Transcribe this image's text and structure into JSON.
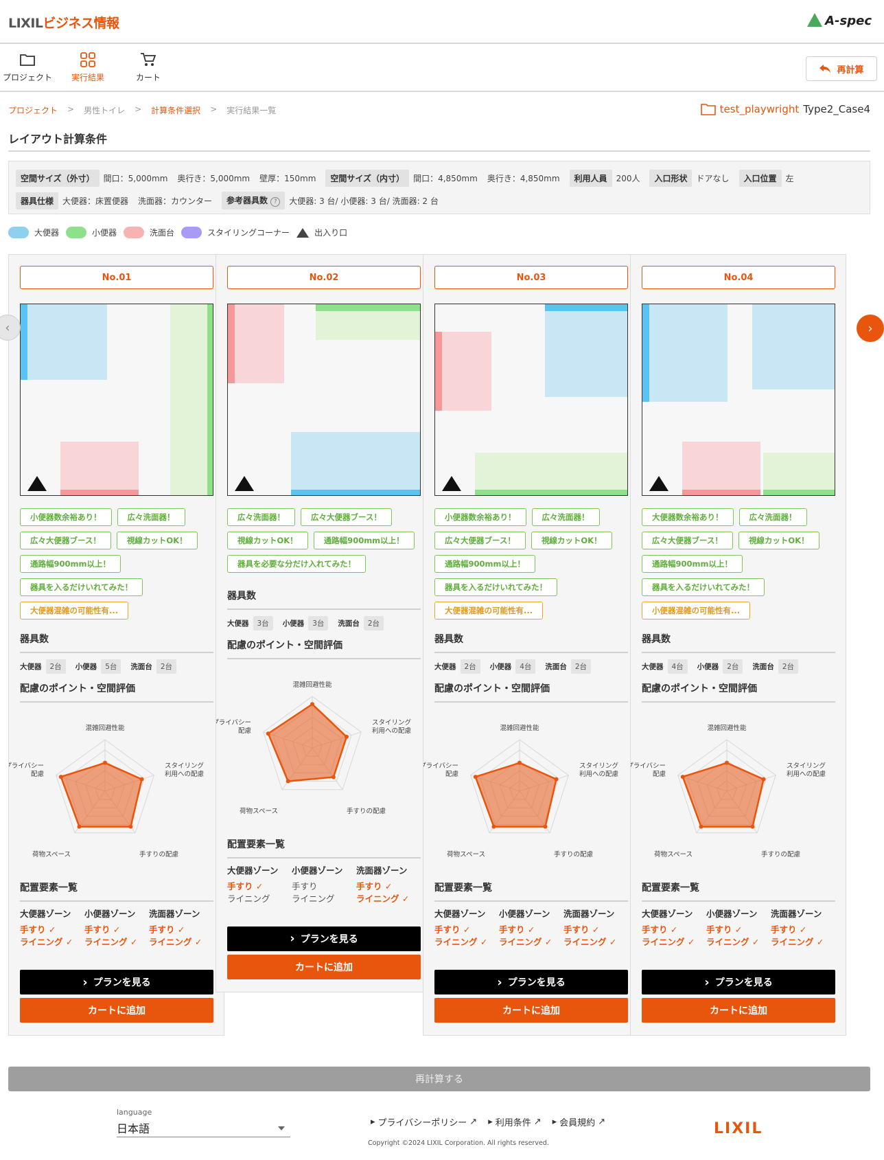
{
  "header": {
    "brand_a": "LIXIL",
    "brand_b": "ビジネス情報",
    "product": "A-spec"
  },
  "toolbar": {
    "items": [
      {
        "label": "プロジェクト",
        "icon": "folder-icon"
      },
      {
        "label": "実行結果",
        "icon": "grid-icon"
      },
      {
        "label": "カート",
        "icon": "cart-icon"
      }
    ],
    "recalc_label": "再計算"
  },
  "breadcrumb": [
    "プロジェクト",
    "男性トイレ",
    "計算条件選択",
    "実行結果一覧"
  ],
  "project": {
    "name": "test_playwright",
    "case": "Type2_Case4"
  },
  "page_title": "レイアウト計算条件",
  "conditions": {
    "outer_tag": "空間サイズ（外寸）",
    "outer_width": "間口：5,000mm",
    "outer_depth": "奥行き：5,000mm",
    "wall": "壁厚：150mm",
    "inner_tag": "空間サイズ（内寸）",
    "inner_width": "間口：4,850mm",
    "inner_depth": "奥行き：4,850mm",
    "users_tag": "利用人員",
    "users": "200人",
    "entry_shape_tag": "入口形状",
    "entry_shape": "ドアなし",
    "entry_pos_tag": "入口位置",
    "entry_pos": "左",
    "spec_tag": "器具仕様",
    "spec_toilet": "大便器：床置便器",
    "spec_sink": "洗面器：カウンター",
    "ref_tag": "参考器具数",
    "ref_counts": "大便器: 3 台/ 小便器: 3 台/ 洗面器: 2 台"
  },
  "legend": [
    {
      "label": "大便器",
      "color": "#8fd0ef"
    },
    {
      "label": "小便器",
      "color": "#8fe08a"
    },
    {
      "label": "洗面台",
      "color": "#f7b2b2"
    },
    {
      "label": "スタイリングコーナー",
      "color": "#a99af5"
    },
    {
      "label": "出入り口"
    }
  ],
  "colors": {
    "accent": "#e8560e",
    "toilet": "#c9e6f5",
    "urinal": "#e3f3d8",
    "sink": "#f8d6d8"
  },
  "radar_axes": [
    "混雑回避性能",
    "スタイリング\n利用への配慮",
    "手すりの配慮",
    "荷物スペース",
    "プライバシー\n配慮"
  ],
  "labels": {
    "counts_title": "器具数",
    "radar_title": "配慮のポイント・空間評価",
    "elements_title": "配置要素一覧",
    "plan_button": "プランを見る",
    "cart_button": "カートに追加",
    "toilet": "大便器",
    "urinal": "小便器",
    "sink": "洗面台",
    "zone_toilet": "大便器ゾーン",
    "zone_urinal": "小便器ゾーン",
    "zone_sink": "洗面器ゾーン",
    "handrail": "手すり",
    "lining": "ライニング"
  },
  "cards": [
    {
      "no": "No.01",
      "chips": [
        {
          "text": "小便器数余裕あり！"
        },
        {
          "text": "広々洗面器！"
        },
        {
          "text": "広々大便器ブース！"
        },
        {
          "text": "視線カットOK！"
        },
        {
          "text": "通路幅900mm以上！"
        },
        {
          "text": "器具を入るだけいれてみた！"
        },
        {
          "text": "大便器混雑の可能性有...",
          "warn": true
        }
      ],
      "counts": {
        "toilet": "2台",
        "urinal": "5台",
        "sink": "2台"
      },
      "scores": [
        0.55,
        0.75,
        0.85,
        0.85,
        0.9
      ],
      "elements": [
        [
          "手すり ✓",
          "ライニング ✓"
        ],
        [
          "手すり ✓",
          "ライニング ✓"
        ],
        [
          "手すり ✓",
          "ライニング ✓"
        ]
      ]
    },
    {
      "no": "No.02",
      "chips": [
        {
          "text": "広々洗面器！"
        },
        {
          "text": "広々大便器ブース！"
        },
        {
          "text": "視線カットOK！"
        },
        {
          "text": "通路幅900mm以上！"
        },
        {
          "text": "器具を必要な分だけ入れてみた！"
        }
      ],
      "counts": {
        "toilet": "3台",
        "urinal": "3台",
        "sink": "2台"
      },
      "scores": [
        0.85,
        0.7,
        0.7,
        0.8,
        0.9
      ],
      "elements": [
        [
          "手すり ✓",
          "ライニング"
        ],
        [
          "手すり",
          "ライニング"
        ],
        [
          "手すり ✓",
          "ライニング ✓"
        ]
      ]
    },
    {
      "no": "No.03",
      "chips": [
        {
          "text": "小便器数余裕あり！"
        },
        {
          "text": "広々洗面器！"
        },
        {
          "text": "広々大便器ブース！"
        },
        {
          "text": "視線カットOK！"
        },
        {
          "text": "通路幅900mm以上！"
        },
        {
          "text": "器具を入るだけいれてみた！"
        },
        {
          "text": "大便器混雑の可能性有...",
          "warn": true
        }
      ],
      "counts": {
        "toilet": "2台",
        "urinal": "4台",
        "sink": "2台"
      },
      "scores": [
        0.55,
        0.75,
        0.85,
        0.85,
        0.9
      ],
      "elements": [
        [
          "手すり ✓",
          "ライニング ✓"
        ],
        [
          "手すり ✓",
          "ライニング ✓"
        ],
        [
          "手すり ✓",
          "ライニング ✓"
        ]
      ]
    },
    {
      "no": "No.04",
      "chips": [
        {
          "text": "大便器数余裕あり！"
        },
        {
          "text": "広々洗面器！"
        },
        {
          "text": "広々大便器ブース！"
        },
        {
          "text": "視線カットOK！"
        },
        {
          "text": "通路幅900mm以上！"
        },
        {
          "text": "器具を入るだけいれてみた！"
        },
        {
          "text": "小便器混雑の可能性有...",
          "warn": true
        }
      ],
      "counts": {
        "toilet": "4台",
        "urinal": "2台",
        "sink": "2台"
      },
      "scores": [
        0.55,
        0.75,
        0.85,
        0.85,
        0.9
      ],
      "elements": [
        [
          "手すり ✓",
          "ライニング ✓"
        ],
        [
          "手すり ✓",
          "ライニング ✓"
        ],
        [
          "手すり ✓",
          "ライニング ✓"
        ]
      ]
    }
  ],
  "recalc_bottom": "再計算する",
  "footer": {
    "language_label": "language",
    "language_value": "日本語",
    "links": [
      "プライバシーポリシー",
      "利用条件",
      "会員規約"
    ],
    "copyright": "Copyright ©2024 LIXIL Corporation. All rights reserved.",
    "logo": "LIXIL"
  }
}
